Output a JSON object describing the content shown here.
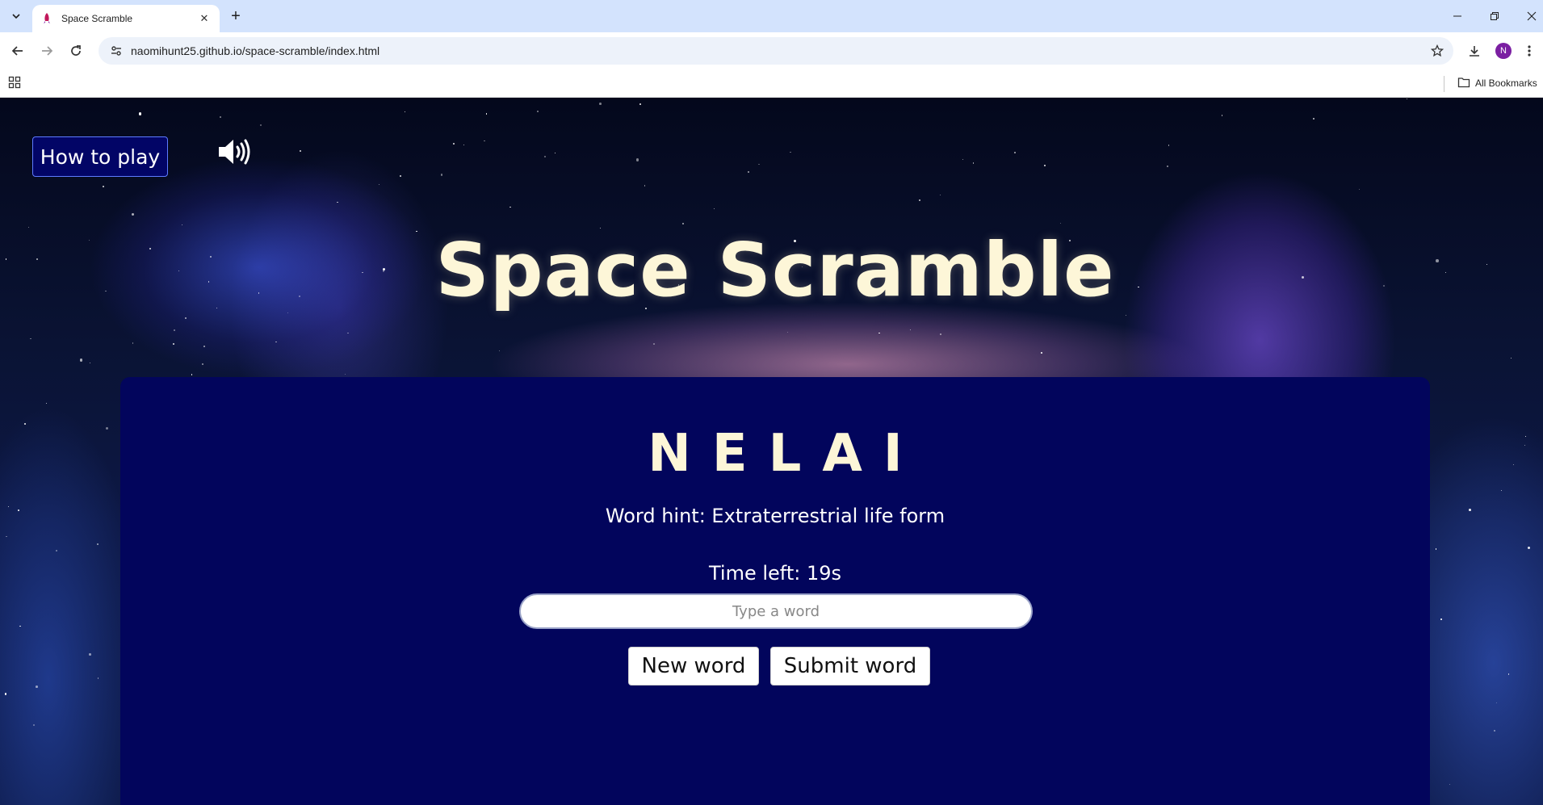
{
  "browser": {
    "tab_title": "Space Scramble",
    "url": "naomihunt25.github.io/space-scramble/index.html",
    "profile_initial": "N",
    "all_bookmarks_label": "All Bookmarks",
    "accent_color": "#d3e3fd"
  },
  "icons": {
    "tab_search": "chevron-down-icon",
    "favicon": "rocket-icon",
    "tab_close": "close-icon",
    "new_tab": "plus-icon",
    "back": "back-arrow-icon",
    "forward": "forward-arrow-icon",
    "reload": "reload-icon",
    "site_info": "tune-icon",
    "bookmark": "star-icon",
    "download": "download-icon",
    "menu": "kebab-menu-icon",
    "apps": "apps-grid-icon",
    "folder": "folder-icon",
    "sound": "speaker-icon"
  },
  "game": {
    "how_to_play_label": "How to play",
    "title": "Space Scramble",
    "scrambled_word": "NELAI",
    "hint_label": "Word hint: ",
    "hint_value": "Extraterrestrial life form",
    "time_label": "Time left: ",
    "time_value": "19s",
    "input_placeholder": "Type a word",
    "input_value": "",
    "new_word_label": "New word",
    "submit_word_label": "Submit word",
    "colors": {
      "panel": "#02055c",
      "title": "#fdf6d8",
      "button_dark": "#020566"
    }
  }
}
